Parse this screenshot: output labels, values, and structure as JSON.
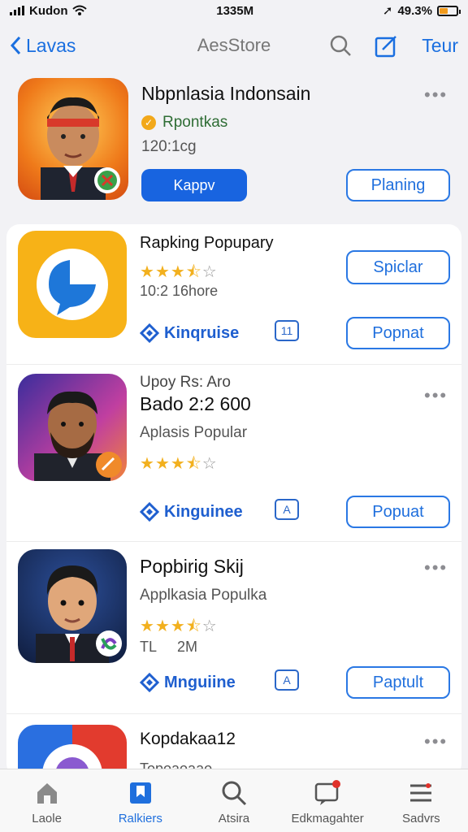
{
  "status": {
    "carrier": "Kudon",
    "time": "1335M",
    "battery": "49.3%",
    "battery_level": 0.5
  },
  "nav": {
    "back": "Lavas",
    "title": "AesStore",
    "action": "Teur"
  },
  "hero": {
    "title": "Nbpnlasia Indonsain",
    "badge": "Rpontkas",
    "meta": "120:1cg",
    "primary_button": "Kappv",
    "secondary_button": "Planing"
  },
  "apps": [
    {
      "title": "Rapking Popupary",
      "meta": "10:2 16hore",
      "rating": 3.5,
      "brand": "Kinqruise",
      "chat": "11",
      "top_button": "Spiclar",
      "bottom_button": "Popnat"
    },
    {
      "overline": "Upoy Rs: Aro",
      "title": "Bado 2:2 600",
      "sub": "Aplasis Popular",
      "rating": 3.5,
      "brand": "Kinguinee",
      "chat": "A",
      "button": "Popuat"
    },
    {
      "title": "Popbirig Skij",
      "sub": "Applkasia Populka",
      "rating": 3.5,
      "meta_left": "TL",
      "meta_right": "2M",
      "brand": "Mnguiine",
      "chat": "A",
      "button": "Paptult"
    },
    {
      "title": "Kopdakaa12",
      "sub": "Topoaoaao"
    }
  ],
  "tabs": [
    {
      "label": "Laole",
      "icon": "home-icon"
    },
    {
      "label": "Ralkiers",
      "icon": "bookmark-icon",
      "active": true
    },
    {
      "label": "Atsira",
      "icon": "search-icon"
    },
    {
      "label": "Edkmagahter",
      "icon": "chat-notification-icon"
    },
    {
      "label": "Sadvrs",
      "icon": "menu-icon"
    }
  ],
  "colors": {
    "accent": "#1f6fdd",
    "star": "#f2b01e",
    "background": "#f2f2f5"
  }
}
